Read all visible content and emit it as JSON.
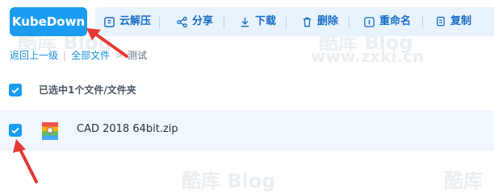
{
  "toolbar": {
    "primary_label": "KubeDown",
    "actions": [
      {
        "label": "云解压",
        "icon": "archive-icon"
      },
      {
        "label": "分享",
        "icon": "share-icon"
      },
      {
        "label": "下载",
        "icon": "download-icon"
      },
      {
        "label": "删除",
        "icon": "trash-icon"
      },
      {
        "label": "重命名",
        "icon": "rename-icon"
      },
      {
        "label": "复制",
        "icon": "copy-icon"
      }
    ]
  },
  "breadcrumb": {
    "back": "返回上一级",
    "root": "全部文件",
    "current": "测试"
  },
  "selection": {
    "text": "已选中1个文件/文件夹",
    "checked": true
  },
  "file": {
    "name": "CAD 2018 64bit.zip",
    "checked": true,
    "icon": "zip-file-icon"
  },
  "watermarks": {
    "cn": "酷库",
    "en": "Blog",
    "url": "www.zxki.cn"
  },
  "colors": {
    "accent": "#1a9cf0",
    "action_bg": "#e8f3fd",
    "action_text": "#1a6dc5",
    "row_bg": "#f0f7fe",
    "arrow": "#e53935"
  }
}
